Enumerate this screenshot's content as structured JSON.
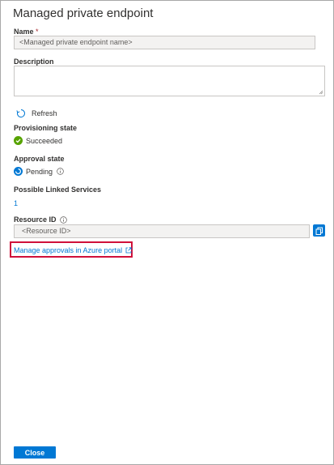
{
  "panel": {
    "title": "Managed private endpoint"
  },
  "name_field": {
    "label": "Name",
    "required_marker": "*",
    "value": "<Managed private endpoint name>"
  },
  "description_field": {
    "label": "Description",
    "value": ""
  },
  "refresh": {
    "label": "Refresh",
    "icon": "refresh-icon"
  },
  "provisioning": {
    "label": "Provisioning state",
    "value": "Succeeded",
    "icon": "success-check-icon",
    "color": "#57a300"
  },
  "approval": {
    "label": "Approval state",
    "value": "Pending",
    "icon": "pending-icon",
    "info_icon": "info-icon",
    "color": "#0078d4"
  },
  "linked_services": {
    "label": "Possible Linked Services",
    "value": "1"
  },
  "resource_id": {
    "label": "Resource ID",
    "info_icon": "info-icon",
    "value": "<Resource ID>",
    "copy_icon": "copy-icon"
  },
  "manage_link": {
    "label": "Manage approvals in Azure portal",
    "icon": "external-link-icon",
    "highlight_color": "#d0103a"
  },
  "footer": {
    "close_label": "Close"
  },
  "colors": {
    "accent": "#0078d4",
    "required": "#a4262c"
  }
}
